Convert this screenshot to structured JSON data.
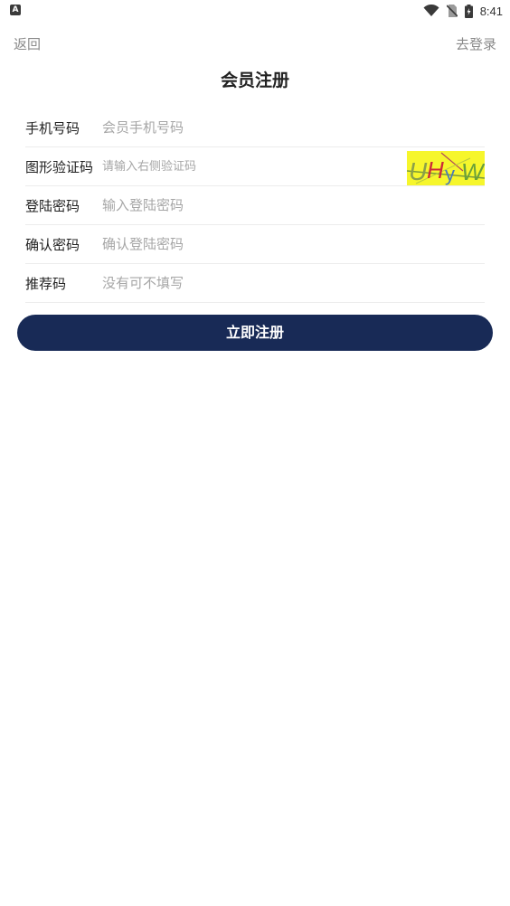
{
  "status_bar": {
    "time": "8:41",
    "left_icon": "A",
    "icons": [
      "wifi-icon",
      "no-sim-icon",
      "battery-icon"
    ]
  },
  "nav": {
    "back_label": "返回",
    "login_label": "去登录"
  },
  "page_title": "会员注册",
  "form": {
    "fields": [
      {
        "label": "手机号码",
        "placeholder": "会员手机号码",
        "value": ""
      },
      {
        "label": "图形验证码",
        "placeholder": "请输入右侧验证码",
        "value": ""
      },
      {
        "label": "登陆密码",
        "placeholder": "输入登陆密码",
        "value": ""
      },
      {
        "label": "确认密码",
        "placeholder": "确认登陆密码",
        "value": ""
      },
      {
        "label": "推荐码",
        "placeholder": "没有可不填写",
        "value": ""
      }
    ],
    "captcha": {
      "text": "UHyW",
      "background": "#f6f62c"
    }
  },
  "submit": {
    "label": "立即注册",
    "color": "#182a56"
  }
}
